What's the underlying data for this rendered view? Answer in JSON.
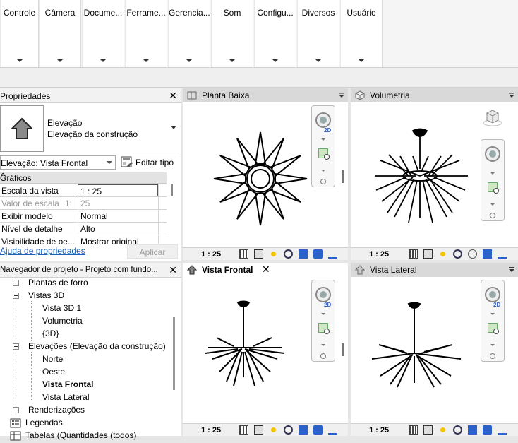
{
  "ribbon": {
    "tabs": [
      {
        "label": "Controle"
      },
      {
        "label": "Câmera"
      },
      {
        "label": "Docume..."
      },
      {
        "label": "Ferrame..."
      },
      {
        "label": "Gerencia..."
      },
      {
        "label": "Som"
      },
      {
        "label": "Configu..."
      },
      {
        "label": "Diversos"
      },
      {
        "label": "Usuário"
      }
    ]
  },
  "properties": {
    "title": "Propriedades",
    "family": "Elevação",
    "type": "Elevação da construção",
    "instance": "Elevação: Vista Frontal",
    "edit_type": "Editar tipo",
    "group": "Gráficos",
    "rows": [
      {
        "key": "Escala da vista",
        "value": "1 : 25"
      },
      {
        "key": "Valor de escala",
        "key_suffix": "1:",
        "value": "25"
      },
      {
        "key": "Exibir modelo",
        "value": "Normal"
      },
      {
        "key": "Nível de detalhe",
        "value": "Alto"
      },
      {
        "key": "Visibilidade de pe...",
        "value": "Mostrar original"
      }
    ],
    "help": "Ajuda de propriedades",
    "apply": "Aplicar"
  },
  "navigator": {
    "title": "Navegador de projeto - Projeto com fundo...",
    "items": [
      {
        "label": "Plantas de forro"
      },
      {
        "label": "Vistas 3D"
      },
      {
        "label": "Vista 3D 1"
      },
      {
        "label": "Volumetria"
      },
      {
        "label": "{3D}"
      },
      {
        "label": "Elevações (Elevação da construção)"
      },
      {
        "label": "Norte"
      },
      {
        "label": "Oeste"
      },
      {
        "label": "Vista Frontal"
      },
      {
        "label": "Vista Lateral"
      },
      {
        "label": "Renderizações"
      },
      {
        "label": "Legendas"
      },
      {
        "label": "Tabelas (Quantidades (todos)"
      }
    ]
  },
  "views": {
    "plan": {
      "title": "Planta Baixa",
      "scale": "1 : 25"
    },
    "volumetria": {
      "title": "Volumetria",
      "scale": "1 : 25"
    },
    "frontal": {
      "title": "Vista Frontal",
      "scale": "1 : 25"
    },
    "lateral": {
      "title": "Vista Lateral",
      "scale": "1 : 25"
    }
  },
  "icons": {
    "close": "close-icon",
    "nav_wheel": "steering-wheel-icon",
    "zoom": "zoom-region-icon",
    "viewcube": "viewcube-icon"
  }
}
